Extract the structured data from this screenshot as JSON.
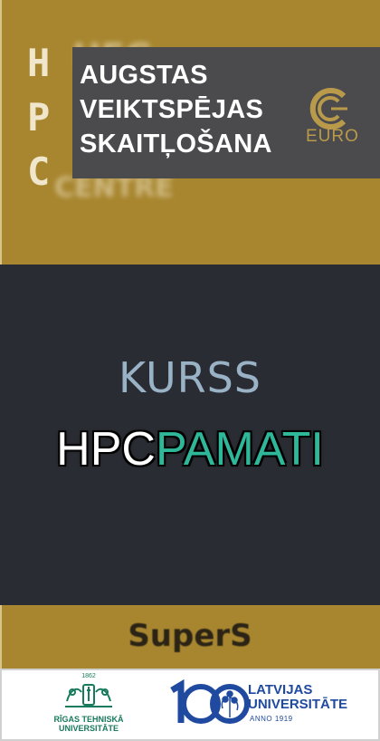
{
  "banner": {
    "letters": [
      "H",
      "P",
      "C"
    ],
    "title_lines": [
      "AUGSTAS",
      "VEIKTSPĒJAS",
      "SKAITĻOŠANA"
    ],
    "euro_label": "EURO",
    "euro_icon": "eurocc-c-icon"
  },
  "course": {
    "kurss": "KURSS",
    "name_part1": "HPC",
    "name_part2": "PAMATI"
  },
  "footer_brand": {
    "name": "SuperS"
  },
  "logos": {
    "rtu": {
      "year": "1862",
      "line1": "RĪGAS TEHNISKĀ",
      "line2": "UNIVERSITĀTE"
    },
    "lu": {
      "line1": "LATVIJAS",
      "line2": "UNIVERSITĀTE",
      "anno": "ANNO 1919"
    }
  },
  "colors": {
    "gold": "#a8862f",
    "dark": "#2a2c33",
    "accent_teal": "#2fb79a",
    "rtu_green": "#177a5d",
    "lu_blue": "#1f4aa0"
  }
}
